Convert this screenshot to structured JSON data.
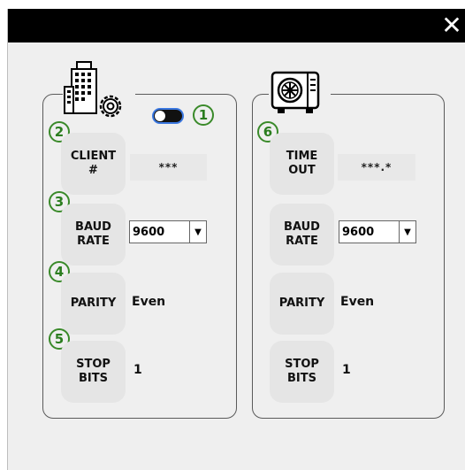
{
  "window": {
    "close_glyph": "✕"
  },
  "badges": {
    "b1": "1",
    "b2": "2",
    "b3": "3",
    "b4": "4",
    "b5": "5",
    "b6": "6"
  },
  "left_panel": {
    "icon": "building-gear-icon",
    "toggle_on": false,
    "client": {
      "line1": "CLIENT",
      "line2": "#",
      "value": "***"
    },
    "baud": {
      "line1": "BAUD",
      "line2": "RATE",
      "selected": "9600"
    },
    "parity": {
      "label": "PARITY",
      "value": "Even"
    },
    "stop": {
      "line1": "STOP",
      "line2": "BITS",
      "value": "1"
    }
  },
  "right_panel": {
    "icon": "outdoor-unit-icon",
    "timeout": {
      "line1": "TIME",
      "line2": "OUT",
      "value": "***.*"
    },
    "baud": {
      "line1": "BAUD",
      "line2": "RATE",
      "selected": "9600"
    },
    "parity": {
      "label": "PARITY",
      "value": "Even"
    },
    "stop": {
      "line1": "STOP",
      "line2": "BITS",
      "value": "1"
    }
  },
  "colors": {
    "accent_green": "#2b7d1f",
    "toggle_ring": "#3b78e0"
  }
}
